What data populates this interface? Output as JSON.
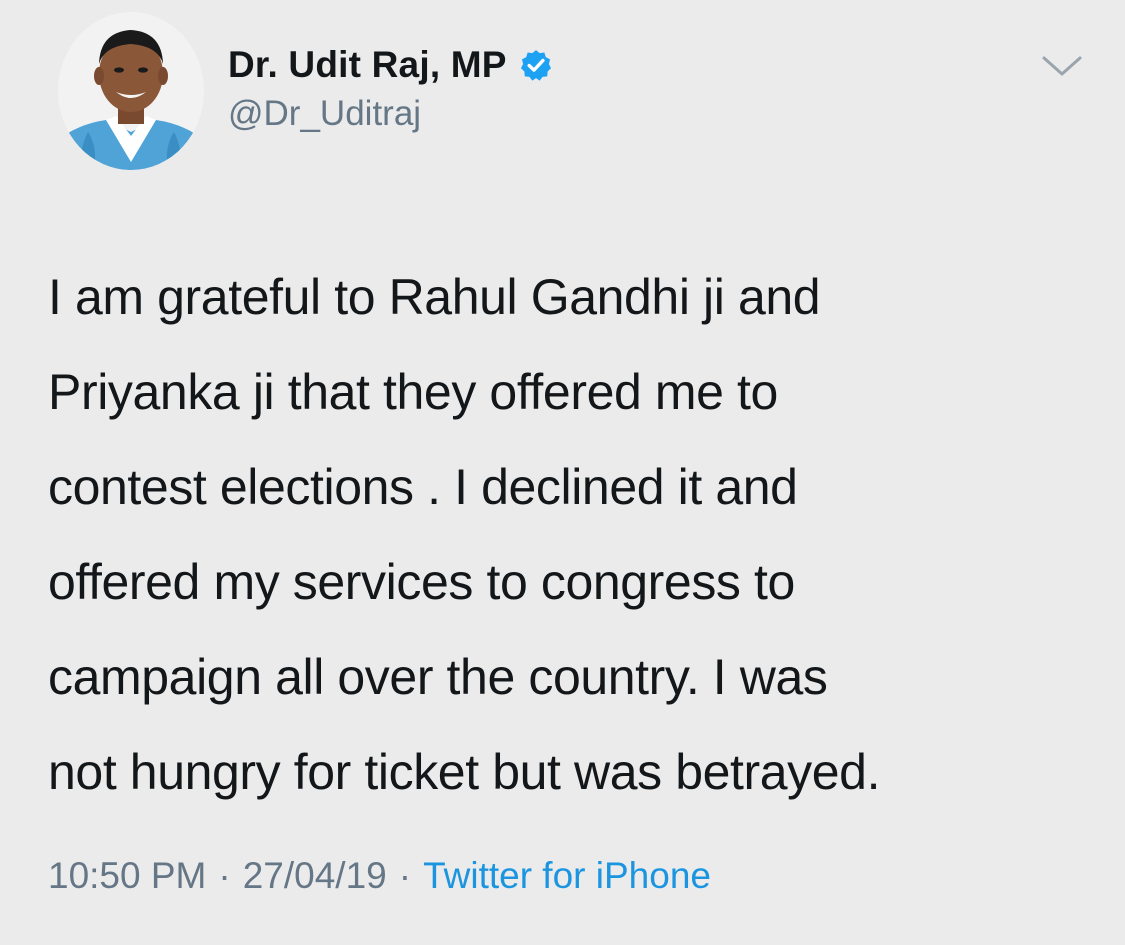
{
  "author": {
    "display_name": "Dr. Udit Raj, MP",
    "handle": "@Dr_Uditraj",
    "verified": true
  },
  "tweet": {
    "lines": [
      "I am grateful to Rahul Gandhi ji and",
      "Priyanka ji that they offered me to",
      "contest elections . I declined it and",
      "offered my services to congress to",
      "campaign all over the country. I was",
      "not hungry for ticket but was betrayed."
    ]
  },
  "meta": {
    "time": "10:50 PM",
    "separator": "·",
    "date": "27/04/19",
    "source": "Twitter for iPhone"
  },
  "icons": {
    "verified": "verified-badge-icon",
    "menu": "chevron-down-icon"
  },
  "colors": {
    "background": "#ebebeb",
    "text": "#14171a",
    "secondary": "#657786",
    "link": "#1b95e0",
    "verified": "#1da1f2"
  }
}
